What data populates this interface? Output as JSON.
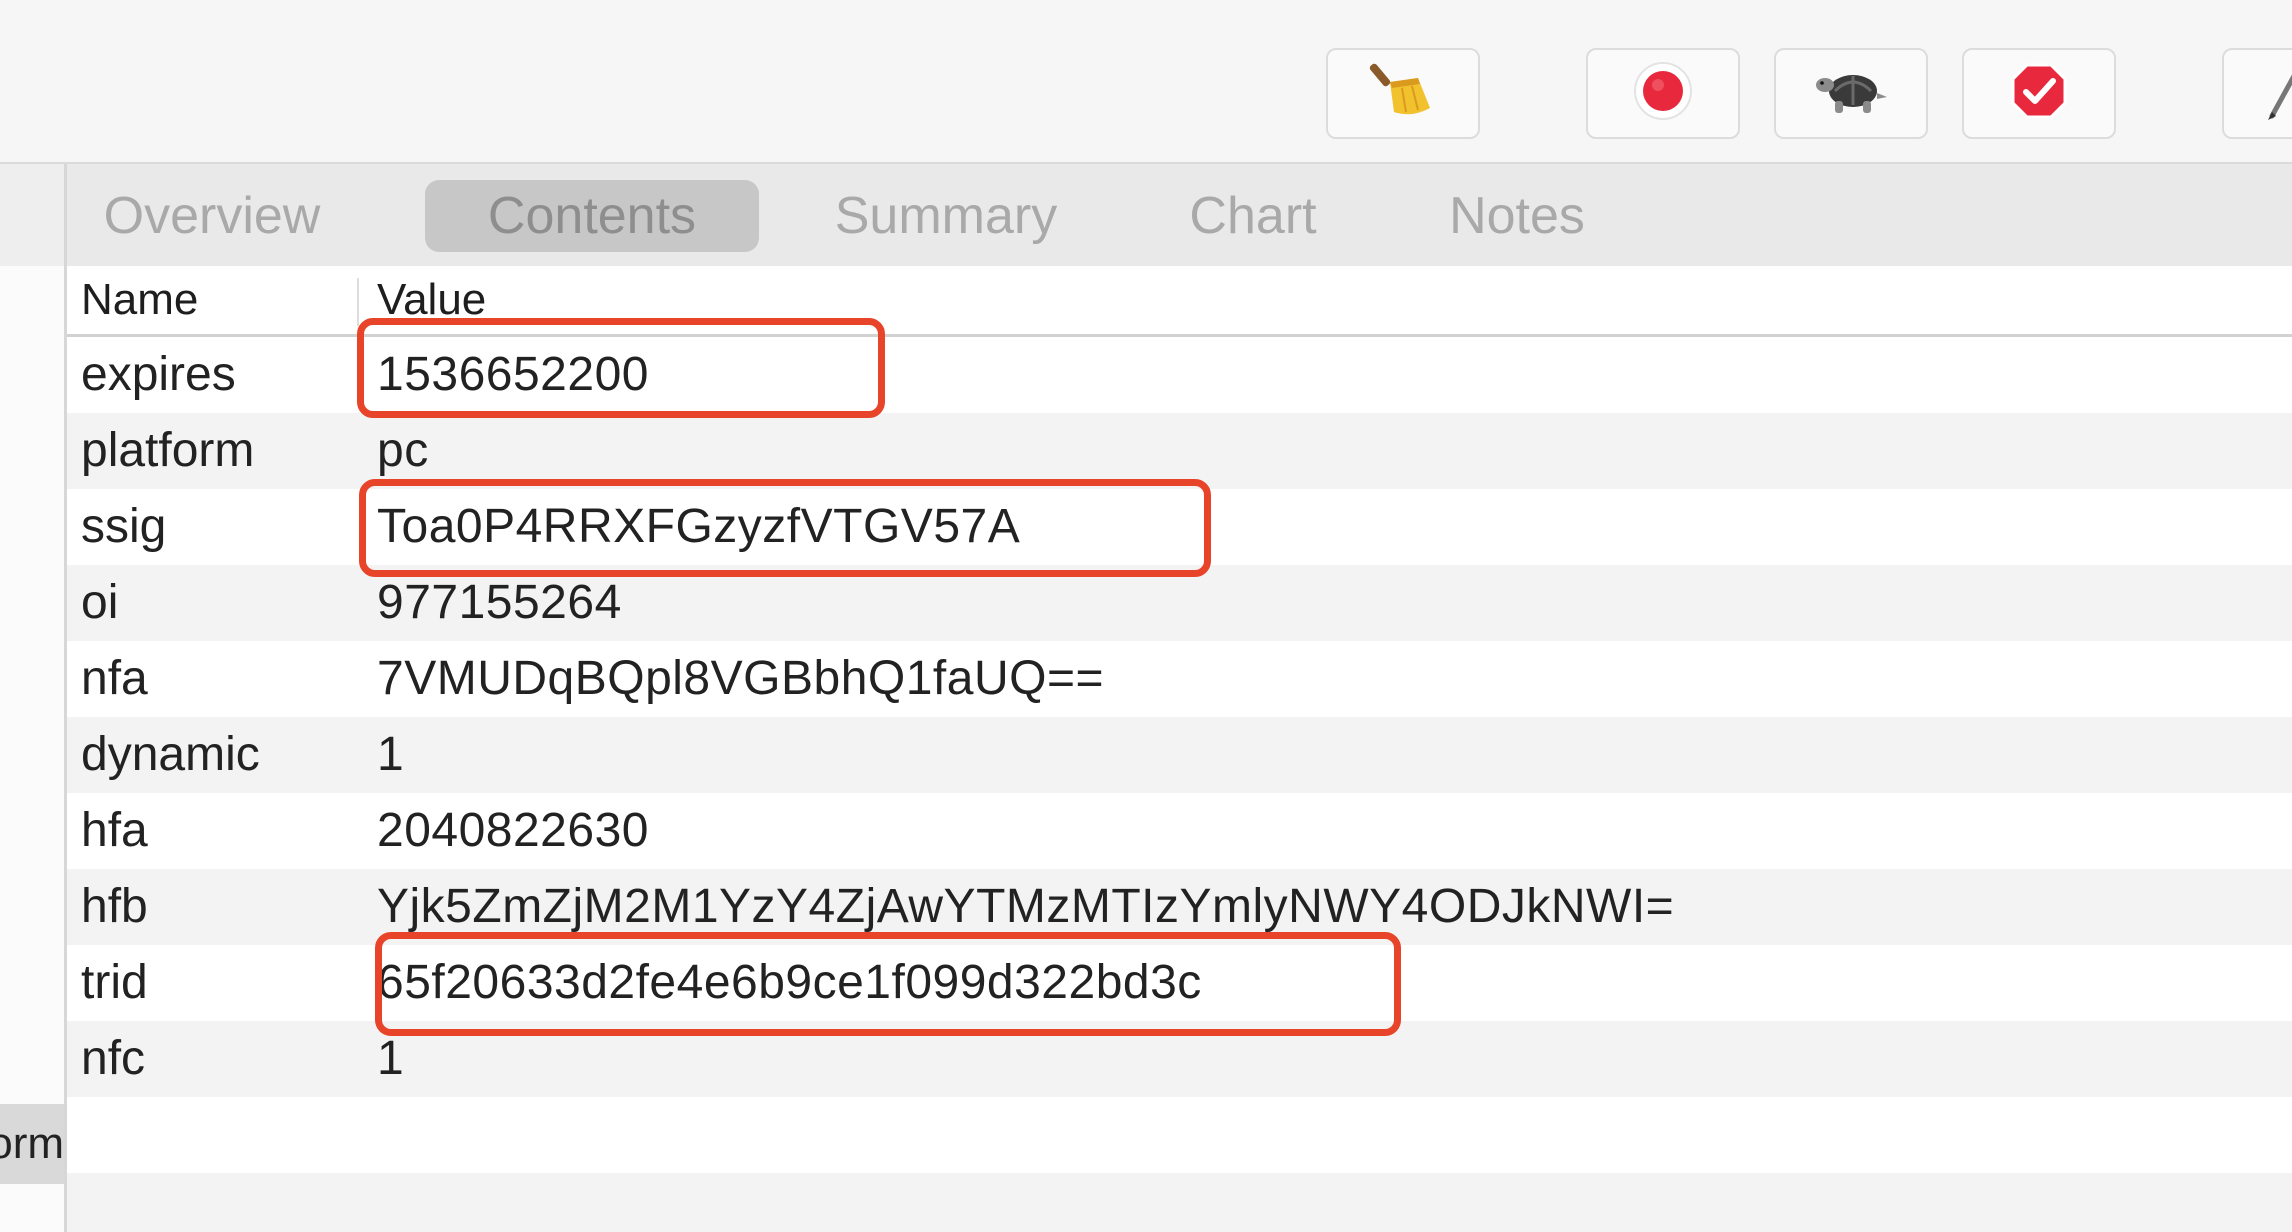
{
  "toolbar": {
    "buttons": [
      {
        "name": "broom-icon"
      },
      {
        "name": "record-icon",
        "color": "#e8283c"
      },
      {
        "name": "turtle-icon"
      },
      {
        "name": "breakpoint-check-icon",
        "color": "#e8283c"
      },
      {
        "name": "pen-icon"
      }
    ]
  },
  "sidebar": {
    "clipped_label": "orm"
  },
  "tabs": [
    {
      "label": "Overview"
    },
    {
      "label": "Contents",
      "active": true
    },
    {
      "label": "Summary"
    },
    {
      "label": "Chart"
    },
    {
      "label": "Notes"
    }
  ],
  "table": {
    "headers": {
      "name": "Name",
      "value": "Value"
    },
    "rows": [
      {
        "name": "expires",
        "value": "1536652200",
        "highlighted": true
      },
      {
        "name": "platform",
        "value": "pc"
      },
      {
        "name": "ssig",
        "value": "Toa0P4RRXFGzyzfVTGV57A",
        "highlighted": true
      },
      {
        "name": "oi",
        "value": "977155264"
      },
      {
        "name": "nfa",
        "value": "7VMUDqBQpl8VGBbhQ1faUQ=="
      },
      {
        "name": "dynamic",
        "value": "1"
      },
      {
        "name": "hfa",
        "value": "2040822630"
      },
      {
        "name": "hfb",
        "value": "Yjk5ZmZjM2M1YzY4ZjAwYTMzMTIzYmlyNWY4ODJkNWI="
      },
      {
        "name": "trid",
        "value": "65f20633d2fe4e6b9ce1f099d322bd3c",
        "highlighted": true
      },
      {
        "name": "nfc",
        "value": "1"
      }
    ]
  },
  "colors": {
    "highlight": "#e8442a",
    "row_alt": "#f3f3f3"
  }
}
